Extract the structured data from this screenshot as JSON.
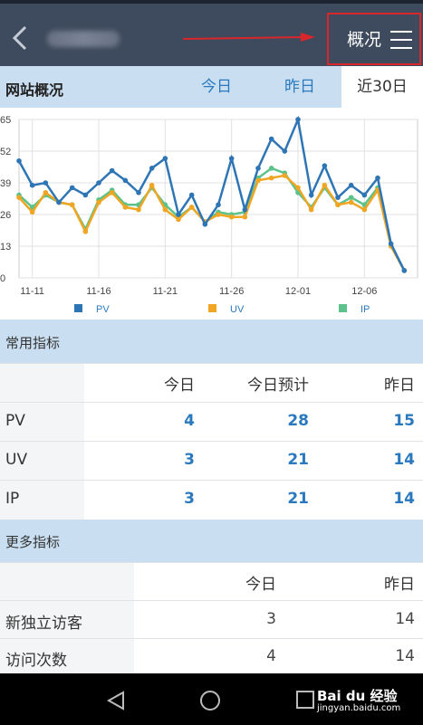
{
  "header": {
    "menu_label": "概况"
  },
  "tabs": {
    "title": "网站概况",
    "items": [
      {
        "label": "今日",
        "active": false
      },
      {
        "label": "昨日",
        "active": false
      },
      {
        "label": "近30日",
        "active": true
      }
    ]
  },
  "chart_data": {
    "type": "line",
    "x": [
      "11-10",
      "11-11",
      "11-12",
      "11-13",
      "11-14",
      "11-15",
      "11-16",
      "11-17",
      "11-18",
      "11-19",
      "11-20",
      "11-21",
      "11-22",
      "11-23",
      "11-24",
      "11-25",
      "11-26",
      "11-27",
      "11-28",
      "11-29",
      "11-30",
      "12-01",
      "12-02",
      "12-03",
      "12-04",
      "12-05",
      "12-06",
      "12-07",
      "12-08",
      "12-09",
      "12-10"
    ],
    "x_tick_labels": [
      "11-11",
      "11-16",
      "11-21",
      "11-26",
      "12-01",
      "12-06"
    ],
    "y_tick_labels": [
      "0",
      "13",
      "26",
      "39",
      "52",
      "65"
    ],
    "ylim": [
      0,
      65
    ],
    "series": [
      {
        "name": "PV",
        "color": "#2e75b6",
        "values": [
          48,
          38,
          39,
          31,
          37,
          34,
          39,
          44,
          40,
          35,
          45,
          49,
          26,
          34,
          22,
          30,
          49,
          28,
          45,
          57,
          52,
          65,
          34,
          46,
          33,
          38,
          34,
          41,
          14,
          3
        ]
      },
      {
        "name": "UV",
        "color": "#f0a623",
        "values": [
          33,
          27,
          35,
          31,
          30,
          19,
          31,
          35,
          29,
          28,
          38,
          28,
          24,
          29,
          23,
          26,
          25,
          25,
          40,
          41,
          42,
          37,
          28,
          38,
          30,
          31,
          28,
          36,
          13,
          3
        ]
      },
      {
        "name": "IP",
        "color": "#5cc28b",
        "values": [
          34,
          29,
          34,
          31,
          30,
          20,
          32,
          36,
          30,
          30,
          37,
          30,
          25,
          29,
          23,
          27,
          26,
          27,
          41,
          45,
          43,
          35,
          29,
          37,
          30,
          33,
          30,
          37,
          13,
          3
        ]
      }
    ]
  },
  "common_metrics": {
    "title": "常用指标",
    "headers": [
      "今日",
      "今日预计",
      "昨日"
    ],
    "rows": [
      {
        "label": "PV",
        "today": "4",
        "forecast": "28",
        "yesterday": "15"
      },
      {
        "label": "UV",
        "today": "3",
        "forecast": "21",
        "yesterday": "14"
      },
      {
        "label": "IP",
        "today": "3",
        "forecast": "21",
        "yesterday": "14"
      }
    ]
  },
  "more_metrics": {
    "title": "更多指标",
    "headers": [
      "今日",
      "昨日"
    ],
    "rows": [
      {
        "label": "新独立访客",
        "today": "3",
        "yesterday": "14"
      },
      {
        "label": "访问次数",
        "today": "4",
        "yesterday": "14"
      }
    ]
  },
  "watermark": {
    "brand": "Bai du 经验",
    "url": "jingyan.baidu.com"
  }
}
